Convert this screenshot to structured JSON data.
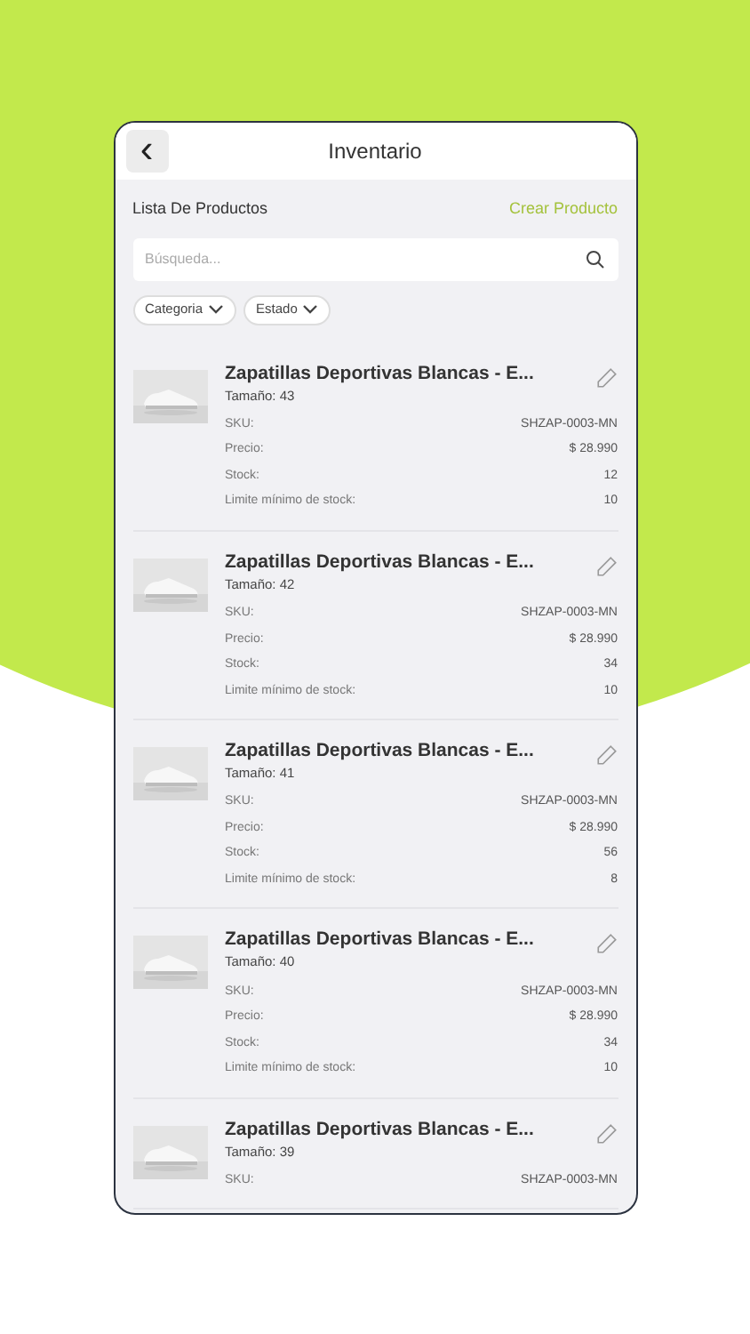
{
  "header": {
    "back": "‹",
    "title": "Inventario"
  },
  "list_title": "Lista De Productos",
  "create_link": "Crear Producto",
  "search": {
    "placeholder": "Búsqueda..."
  },
  "filters": [
    {
      "label": "Categoria"
    },
    {
      "label": "Estado"
    }
  ],
  "products": [
    {
      "name": "Zapatillas Deportivas Blancas - E...",
      "size": "Tamaño: 43",
      "fields": [
        {
          "label": "SKU:",
          "value": "SHZAP-0003-MN"
        },
        {
          "label": "Precio:",
          "value": "$ 28.990"
        },
        {
          "label": "Stock:",
          "value": "12"
        },
        {
          "label": "Limite mínimo de stock:",
          "value": "10"
        }
      ]
    },
    {
      "name": "Zapatillas Deportivas Blancas - E...",
      "size": "Tamaño: 42",
      "fields": [
        {
          "label": "SKU:",
          "value": "SHZAP-0003-MN"
        },
        {
          "label": "Precio:",
          "value": "$ 28.990"
        },
        {
          "label": "Stock:",
          "value": "34"
        },
        {
          "label": "Limite mínimo de stock:",
          "value": "10"
        }
      ]
    },
    {
      "name": "Zapatillas Deportivas Blancas - E...",
      "size": "Tamaño: 41",
      "fields": [
        {
          "label": "SKU:",
          "value": "SHZAP-0003-MN"
        },
        {
          "label": "Precio:",
          "value": "$ 28.990"
        },
        {
          "label": "Stock:",
          "value": "56"
        },
        {
          "label": "Limite mínimo de stock:",
          "value": "8"
        }
      ]
    },
    {
      "name": "Zapatillas Deportivas Blancas - E...",
      "size": "Tamaño: 40",
      "fields": [
        {
          "label": "SKU:",
          "value": "SHZAP-0003-MN"
        },
        {
          "label": "Precio:",
          "value": "$ 28.990"
        },
        {
          "label": "Stock:",
          "value": "34"
        },
        {
          "label": "Limite mínimo de stock:",
          "value": "10"
        }
      ]
    },
    {
      "name": "Zapatillas Deportivas Blancas - E...",
      "size": "Tamaño: 39",
      "fields": [
        {
          "label": "SKU:",
          "value": "SHZAP-0003-MN"
        }
      ]
    }
  ]
}
